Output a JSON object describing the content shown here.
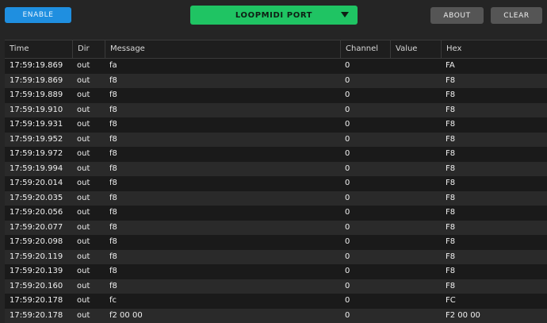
{
  "toolbar": {
    "enable_label": "ENABLE",
    "port_label": "LOOPMIDI PORT",
    "about_label": "ABOUT",
    "clear_label": "CLEAR"
  },
  "table": {
    "columns": [
      "Time",
      "Dir",
      "Message",
      "Channel",
      "Value",
      "Hex"
    ],
    "rows": [
      {
        "time": "17:59:19.869",
        "dir": "out",
        "message": "fa",
        "channel": "0",
        "value": "",
        "hex": "FA"
      },
      {
        "time": "17:59:19.869",
        "dir": "out",
        "message": "f8",
        "channel": "0",
        "value": "",
        "hex": "F8"
      },
      {
        "time": "17:59:19.889",
        "dir": "out",
        "message": "f8",
        "channel": "0",
        "value": "",
        "hex": "F8"
      },
      {
        "time": "17:59:19.910",
        "dir": "out",
        "message": "f8",
        "channel": "0",
        "value": "",
        "hex": "F8"
      },
      {
        "time": "17:59:19.931",
        "dir": "out",
        "message": "f8",
        "channel": "0",
        "value": "",
        "hex": "F8"
      },
      {
        "time": "17:59:19.952",
        "dir": "out",
        "message": "f8",
        "channel": "0",
        "value": "",
        "hex": "F8"
      },
      {
        "time": "17:59:19.972",
        "dir": "out",
        "message": "f8",
        "channel": "0",
        "value": "",
        "hex": "F8"
      },
      {
        "time": "17:59:19.994",
        "dir": "out",
        "message": "f8",
        "channel": "0",
        "value": "",
        "hex": "F8"
      },
      {
        "time": "17:59:20.014",
        "dir": "out",
        "message": "f8",
        "channel": "0",
        "value": "",
        "hex": "F8"
      },
      {
        "time": "17:59:20.035",
        "dir": "out",
        "message": "f8",
        "channel": "0",
        "value": "",
        "hex": "F8"
      },
      {
        "time": "17:59:20.056",
        "dir": "out",
        "message": "f8",
        "channel": "0",
        "value": "",
        "hex": "F8"
      },
      {
        "time": "17:59:20.077",
        "dir": "out",
        "message": "f8",
        "channel": "0",
        "value": "",
        "hex": "F8"
      },
      {
        "time": "17:59:20.098",
        "dir": "out",
        "message": "f8",
        "channel": "0",
        "value": "",
        "hex": "F8"
      },
      {
        "time": "17:59:20.119",
        "dir": "out",
        "message": "f8",
        "channel": "0",
        "value": "",
        "hex": "F8"
      },
      {
        "time": "17:59:20.139",
        "dir": "out",
        "message": "f8",
        "channel": "0",
        "value": "",
        "hex": "F8"
      },
      {
        "time": "17:59:20.160",
        "dir": "out",
        "message": "f8",
        "channel": "0",
        "value": "",
        "hex": "F8"
      },
      {
        "time": "17:59:20.178",
        "dir": "out",
        "message": "fc",
        "channel": "0",
        "value": "",
        "hex": "FC"
      },
      {
        "time": "17:59:20.178",
        "dir": "out",
        "message": "f2 00 00",
        "channel": "0",
        "value": "",
        "hex": "F2 00 00"
      }
    ]
  },
  "colors": {
    "enable": "#1f8fe0",
    "port": "#1fc463",
    "button_gray": "#555555",
    "background": "#252525",
    "row_dark": "#1a1a1a",
    "row_light": "#2a2a2a"
  },
  "icons": {
    "port_dropdown": "caret-down-icon"
  }
}
